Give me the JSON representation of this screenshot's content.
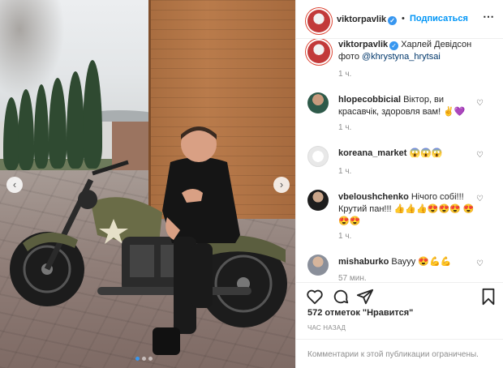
{
  "post": {
    "username": "viktorpavlik",
    "follow_label": "Подписаться",
    "dot": "•",
    "more_icon": "more-horizontal-icon"
  },
  "caption": {
    "username": "viktorpavlik",
    "text": "Харлей Девідсон",
    "line2_prefix": "фото ",
    "mention": "@khrystyna_hrytsai",
    "time": "1 ч."
  },
  "comments": [
    {
      "username": "hlopecobbicial",
      "text": "Віктор, ви красавчік, здоровля вам! ✌💜",
      "time": "1 ч."
    },
    {
      "username": "koreana_market",
      "text": "😱😱😱",
      "time": "1 ч."
    },
    {
      "username": "vbeloushchenko",
      "text": "Нічого собі!!! Крутий пан!!! 👍👍👍😍😍😍 😍😍😍",
      "time": "1 ч."
    },
    {
      "username": "mishaburko",
      "text": "Вауyy 😍💪💪",
      "time": "57 мин."
    }
  ],
  "likes_label": "572 отметок \"Нравится\"",
  "time_ago": "ЧАС НАЗАД",
  "comments_disabled": "Комментарии к этой публикации ограничены.",
  "carousel": {
    "count": 3,
    "active": 0
  },
  "colors": {
    "accent": "#0095f6",
    "verified": "#3897f0",
    "muted": "#8e8e8e"
  }
}
